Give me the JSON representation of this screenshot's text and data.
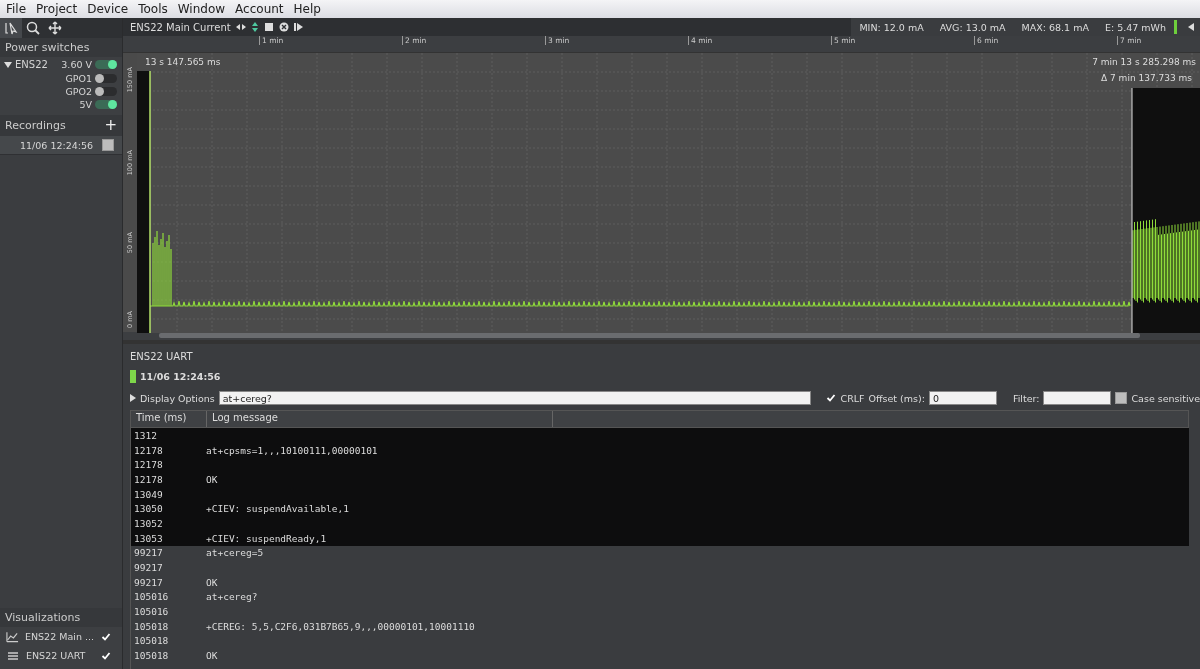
{
  "menu": [
    "File",
    "Project",
    "Device",
    "Tools",
    "Window",
    "Account",
    "Help"
  ],
  "sidebar": {
    "tools": [
      {
        "kind": "cursor",
        "selected": true
      },
      {
        "kind": "zoom",
        "selected": false
      },
      {
        "kind": "pan",
        "selected": false
      }
    ],
    "power_switches": {
      "title": "Power switches",
      "device": "ENS22",
      "expanded": true,
      "switches": [
        {
          "label": "3.60 V",
          "on": true
        },
        {
          "label": "GPO1",
          "on": false
        },
        {
          "label": "GPO2",
          "on": false
        },
        {
          "label": "5V",
          "on": true
        }
      ]
    },
    "recordings": {
      "title": "Recordings",
      "add": "+",
      "items": [
        {
          "label": "11/06 12:24:56",
          "checked": false
        }
      ]
    },
    "visualizations": {
      "title": "Visualizations",
      "items": [
        {
          "kind": "chart",
          "label": "ENS22 Main ...",
          "checked": true
        },
        {
          "kind": "log",
          "label": "ENS22 UART",
          "checked": true
        }
      ]
    }
  },
  "chart_panel": {
    "title": "ENS22 Main Current",
    "stats": [
      "MIN: 12.0 mA",
      "AVG: 13.0 mA",
      "MAX: 68.1 mA",
      "E: 5.47 mWh"
    ],
    "time_ticks": [
      "1 min",
      "2 min",
      "3 min",
      "4 min",
      "5 min",
      "6 min",
      "7 min"
    ],
    "current_ticks": [
      "150 mA",
      "100 mA",
      "50 mA",
      "0 mA"
    ],
    "cursor_left": "13 s 147.565 ms",
    "cursor_right": "7 min 13 s 285.298 ms",
    "cursor_delta": "Δ 7 min 137.733 ms"
  },
  "uart_panel": {
    "title": "ENS22 UART",
    "recording": "11/06 12:24:56",
    "display_options": {
      "label": "Display Options",
      "expanded": false
    },
    "command": "at+cereg?",
    "crlf": {
      "label": "CRLF",
      "checked": true
    },
    "offset": {
      "label": "Offset (ms):",
      "value": "0"
    },
    "filter": {
      "label": "Filter:"
    },
    "case_sensitive": {
      "label": "Case sensitive",
      "checked": false
    },
    "columns": [
      "Time (ms)",
      "Log message"
    ],
    "rows": [
      {
        "time": "1312",
        "selected": true
      },
      {
        "time": "12178",
        "message": "at+cpsms=1,,,10100111,00000101",
        "selected": true
      },
      {
        "time": "12178",
        "selected": true
      },
      {
        "time": "12178",
        "message": "OK",
        "selected": true
      },
      {
        "time": "13049",
        "selected": true
      },
      {
        "time": "13050",
        "message": "+CIEV: suspendAvailable,1",
        "selected": true
      },
      {
        "time": "13052",
        "selected": true
      },
      {
        "time": "13053",
        "message": "+CIEV: suspendReady,1",
        "selected": true
      },
      {
        "time": "99217",
        "message": "at+cereg=5",
        "selected": false
      },
      {
        "time": "99217",
        "selected": false
      },
      {
        "time": "99217",
        "message": "OK",
        "selected": false
      },
      {
        "time": "105016",
        "message": "at+cereg?",
        "selected": false
      },
      {
        "time": "105016",
        "selected": false
      },
      {
        "time": "105018",
        "message": "+CEREG: 5,5,C2F6,031B7B65,9,,,00000101,10001110",
        "selected": false
      },
      {
        "time": "105018",
        "selected": false
      },
      {
        "time": "105018",
        "message": "OK",
        "selected": false
      }
    ]
  }
}
